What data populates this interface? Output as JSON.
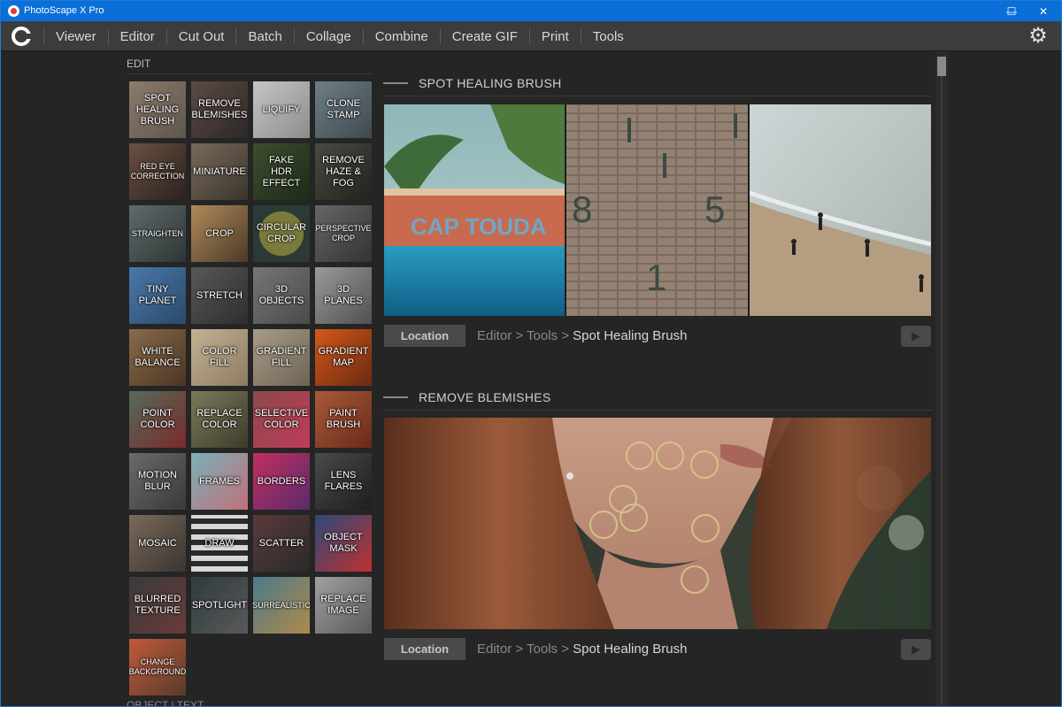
{
  "window": {
    "title": "PhotoScape X Pro",
    "controls": {
      "minimize": "—",
      "maximize": "☐",
      "close": "✕"
    }
  },
  "menu": {
    "items": [
      "Viewer",
      "Editor",
      "Cut Out",
      "Batch",
      "Collage",
      "Combine",
      "Create GIF",
      "Print",
      "Tools"
    ],
    "settings_icon": "gear-icon"
  },
  "edit_panel": {
    "section_label": "EDIT",
    "next_section_label": "OBJECT | TEXT",
    "tools": [
      "SPOT\nHEALING\nBRUSH",
      "REMOVE\nBLEMISHES",
      "LIQUIFY",
      "CLONE\nSTAMP",
      "RED EYE\nCORRECTION",
      "MINIATURE",
      "FAKE\nHDR EFFECT",
      "REMOVE\nHAZE & FOG",
      "STRAIGHTEN",
      "CROP",
      "CIRCULAR\nCROP",
      "PERSPECTIVE\nCROP",
      "TINY\nPLANET",
      "STRETCH",
      "3D\nOBJECTS",
      "3D\nPLANES",
      "WHITE\nBALANCE",
      "COLOR\nFILL",
      "GRADIENT\nFILL",
      "GRADIENT\nMAP",
      "POINT\nCOLOR",
      "REPLACE\nCOLOR",
      "SELECTIVE\nCOLOR",
      "PAINT\nBRUSH",
      "MOTION\nBLUR",
      "FRAMES",
      "BORDERS",
      "LENS\nFLARES",
      "MOSAIC",
      "DRAW",
      "SCATTER",
      "OBJECT\nMASK",
      "BLURRED\nTEXTURE",
      "SPOTLIGHT",
      "SURREALISTIC",
      "REPLACE\nIMAGE",
      "CHANGE\nBACKGROUND"
    ]
  },
  "features": [
    {
      "title": "SPOT HEALING BRUSH",
      "location_button": "Location",
      "breadcrumb": {
        "a": "Editor",
        "sep": ">",
        "b": "Tools",
        "current": "Spot Healing Brush"
      },
      "image_texts": [
        "CAP TOUDA",
        "8",
        "1",
        "5"
      ]
    },
    {
      "title": "REMOVE BLEMISHES",
      "location_button": "Location",
      "breadcrumb": {
        "a": "Editor",
        "sep": ">",
        "b": "Tools",
        "current": "Spot Healing Brush"
      }
    }
  ],
  "play_icon": "▶"
}
